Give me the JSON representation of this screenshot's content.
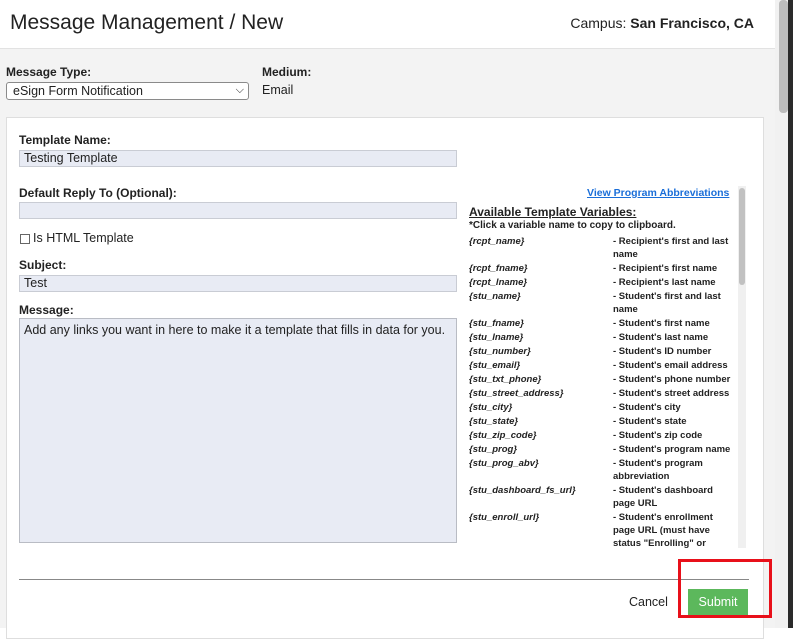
{
  "header": {
    "title": "Message Management / New",
    "campus_label": "Campus:",
    "campus_value": "San Francisco, CA"
  },
  "form": {
    "message_type_label": "Message Type:",
    "message_type_value": "eSign Form Notification",
    "medium_label": "Medium:",
    "medium_value": "Email",
    "template_name_label": "Template Name:",
    "template_name_value": "Testing Template",
    "reply_to_label": "Default Reply To (Optional):",
    "reply_to_value": "",
    "is_html_label": "Is HTML Template",
    "is_html_checked": false,
    "subject_label": "Subject:",
    "subject_value": "Test",
    "message_label": "Message:",
    "message_value": "Add any links you want in here to make it a template that fills in data for you."
  },
  "variables": {
    "abbr_link": "View Program Abbreviations",
    "title": "Available Template Variables:",
    "note": "*Click a variable name to copy to clipboard.",
    "items": [
      {
        "name": "{rcpt_name}",
        "desc": "- Recipient's first and last name"
      },
      {
        "name": "{rcpt_fname}",
        "desc": "- Recipient's first name"
      },
      {
        "name": "{rcpt_lname}",
        "desc": "- Recipient's last name"
      },
      {
        "name": "{stu_name}",
        "desc": "- Student's first and last name"
      },
      {
        "name": "{stu_fname}",
        "desc": "- Student's first name"
      },
      {
        "name": "{stu_lname}",
        "desc": "- Student's last name"
      },
      {
        "name": "{stu_number}",
        "desc": "- Student's ID number"
      },
      {
        "name": "{stu_email}",
        "desc": "- Student's email address"
      },
      {
        "name": "{stu_txt_phone}",
        "desc": "- Student's phone number"
      },
      {
        "name": "{stu_street_address}",
        "desc": "- Student's street address"
      },
      {
        "name": "{stu_city}",
        "desc": "- Student's city"
      },
      {
        "name": "{stu_state}",
        "desc": "- Student's state"
      },
      {
        "name": "{stu_zip_code}",
        "desc": "- Student's zip code"
      },
      {
        "name": "{stu_prog}",
        "desc": "- Student's program name"
      },
      {
        "name": "{stu_prog_abv}",
        "desc": "- Student's program abbreviation"
      },
      {
        "name": "{stu_dashboard_fs_url}",
        "desc": "- Student's dashboard page URL"
      },
      {
        "name": "{stu_enroll_url}",
        "desc": "- Student's enrollment page URL (must have status \"Enrolling\" or"
      }
    ]
  },
  "actions": {
    "cancel_label": "Cancel",
    "submit_label": "Submit"
  },
  "colors": {
    "submit_bg": "#5cb85c",
    "link": "#1a6ed8",
    "highlight": "#e8101a",
    "input_bg": "#e8ebf4"
  }
}
